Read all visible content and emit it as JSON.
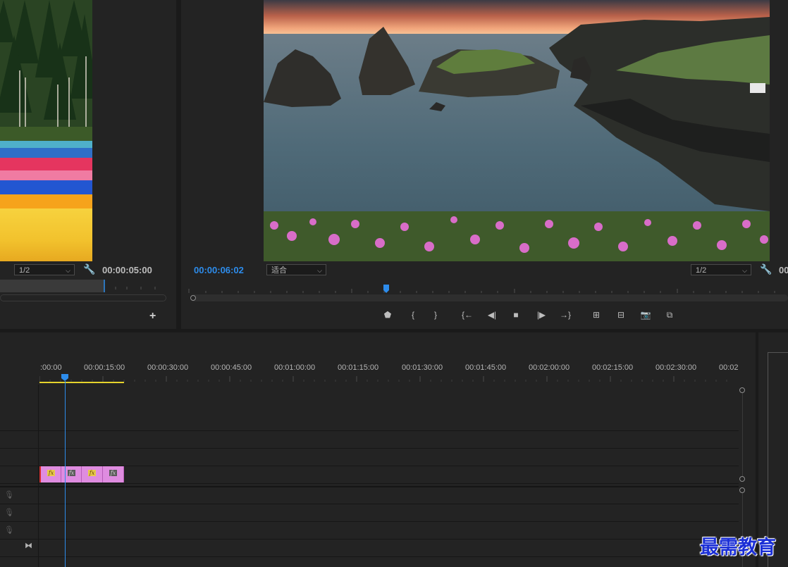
{
  "source_monitor": {
    "resolution": "1/2",
    "duration_timecode": "00:00:05:00",
    "add_icon": "plus-icon",
    "wrench_icon": "wrench-icon"
  },
  "program_monitor": {
    "playhead_timecode": "00:00:06:02",
    "zoom_fit": "适合",
    "resolution": "1/2",
    "duration_timecode_partial": "00",
    "controls": [
      {
        "name": "add-marker-button",
        "glyph": "⬟",
        "icon": "marker-icon"
      },
      {
        "name": "mark-in-button",
        "glyph": "{",
        "icon": "mark-in-icon"
      },
      {
        "name": "mark-out-button",
        "glyph": "}",
        "icon": "mark-out-icon"
      },
      {
        "name": "go-to-in-button",
        "glyph": "{←",
        "icon": "go-to-in-icon"
      },
      {
        "name": "step-back-button",
        "glyph": "◀|",
        "icon": "step-back-icon"
      },
      {
        "name": "stop-button",
        "glyph": "■",
        "icon": "stop-icon"
      },
      {
        "name": "step-forward-button",
        "glyph": "|▶",
        "icon": "step-forward-icon"
      },
      {
        "name": "go-to-out-button",
        "glyph": "→}",
        "icon": "go-to-out-icon"
      },
      {
        "name": "lift-button",
        "glyph": "⊞",
        "icon": "lift-icon"
      },
      {
        "name": "extract-button",
        "glyph": "⊟",
        "icon": "extract-icon"
      },
      {
        "name": "export-frame-button",
        "glyph": "📷",
        "icon": "camera-icon"
      },
      {
        "name": "compare-view-button",
        "glyph": "⧉",
        "icon": "compare-icon"
      }
    ]
  },
  "timeline": {
    "ruler_labels": [
      ":00:00",
      "00:00:15:00",
      "00:00:30:00",
      "00:00:45:00",
      "00:01:00:00",
      "00:01:15:00",
      "00:01:30:00",
      "00:01:45:00",
      "00:02:00:00",
      "00:02:15:00",
      "00:02:30:00",
      "00:02"
    ],
    "clips": [
      {
        "badge": "fx",
        "style": "yellow"
      },
      {
        "badge": "fx",
        "style": "gray"
      },
      {
        "badge": "fx",
        "style": "yellow"
      },
      {
        "badge": "fx",
        "style": "gray"
      }
    ],
    "audio_track_icons": [
      "microphone-icon",
      "microphone-icon",
      "microphone-icon"
    ],
    "sync_icon": "bowtie-icon"
  },
  "watermark": "最需教育"
}
